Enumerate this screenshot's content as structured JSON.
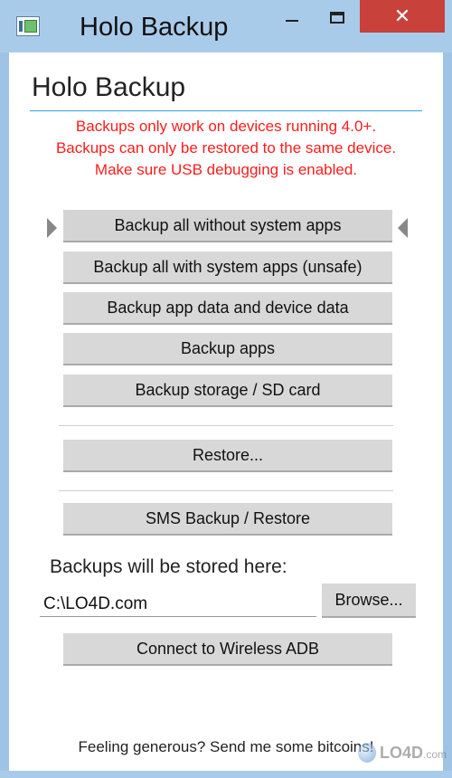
{
  "window": {
    "title": "Holo Backup",
    "minimize_glyph": "",
    "close_glyph": "✕"
  },
  "header": {
    "title": "Holo Backup"
  },
  "warnings": [
    "Backups only work on devices running 4.0+.",
    "Backups can only be restored to the same device.",
    "Make sure USB debugging is enabled."
  ],
  "buttons": {
    "backup_all_no_system": "Backup all without system apps",
    "backup_all_system": "Backup all with system apps (unsafe)",
    "backup_app_device_data": "Backup app data and device data",
    "backup_apps": "Backup apps",
    "backup_storage": "Backup storage / SD card",
    "restore": "Restore...",
    "sms": "SMS Backup / Restore",
    "browse": "Browse...",
    "wireless_adb": "Connect to Wireless ADB"
  },
  "storage": {
    "label": "Backups will be stored here:",
    "path": "C:\\LO4D.com"
  },
  "footer": {
    "text": "Feeling generous? Send me some bitcoins!"
  },
  "watermark": {
    "text": "LO4D",
    "suffix": ".com"
  },
  "colors": {
    "warning": "#ff1c1c",
    "accent_rule": "#33a0dd",
    "button_bg": "#d8d8d8",
    "close_button": "#c9413b",
    "titlebar": "#a9cbea"
  }
}
